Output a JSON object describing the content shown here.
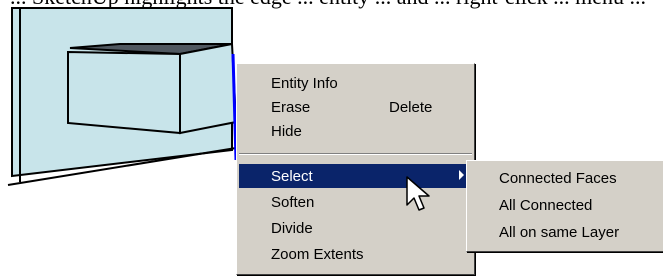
{
  "top_text": "... SketchUp highlights the edge ... entity ... and ... right-click ... menu ...",
  "context_menu": {
    "items": [
      {
        "label": "Entity Info",
        "accel": ""
      },
      {
        "label": "Erase",
        "accel": "Delete"
      },
      {
        "label": "Hide",
        "accel": ""
      },
      {
        "label": "Select",
        "accel": "",
        "submenu": true,
        "highlighted": true
      },
      {
        "label": "Soften",
        "accel": ""
      },
      {
        "label": "Divide",
        "accel": ""
      },
      {
        "label": "Zoom Extents",
        "accel": ""
      }
    ]
  },
  "submenu": {
    "items": [
      {
        "label": "Connected Faces"
      },
      {
        "label": "All Connected"
      },
      {
        "label": "All on same Layer"
      }
    ]
  },
  "colors": {
    "menu_bg": "#d4d0c8",
    "highlight_bg": "#0a246a",
    "face_fill": "#c8e4ea",
    "selected_edge": "#0000ff"
  }
}
